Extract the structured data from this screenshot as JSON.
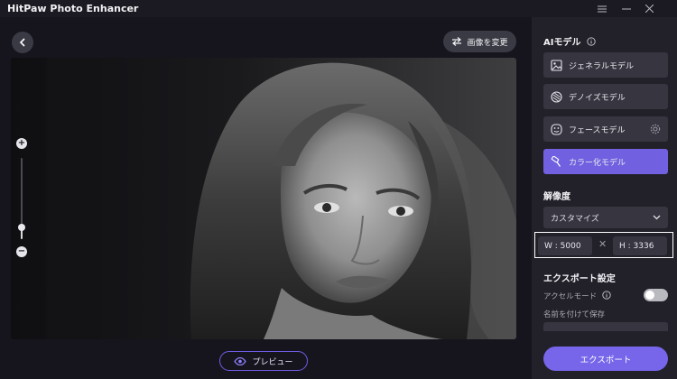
{
  "app": {
    "title": "HitPaw Photo Enhancer"
  },
  "window_controls": {
    "menu_icon": "hamburger-icon",
    "minimize_icon": "minimize-icon",
    "close_icon": "close-icon"
  },
  "toolbar": {
    "back_icon": "chevron-left-icon",
    "change_image_label": "画像を変更",
    "change_image_icon": "swap-arrows-icon"
  },
  "canvas": {
    "image": "black-and-white portrait of a young woman with long hair",
    "zoom_in_label": "+",
    "zoom_out_label": "−",
    "zoom_level": 0.15
  },
  "preview": {
    "label": "プレビュー",
    "icon": "eye-icon"
  },
  "panel": {
    "ai_model_title": "AIモデル",
    "models": [
      {
        "label": "ジェネラルモデル",
        "icon": "image-icon",
        "active": false
      },
      {
        "label": "デノイズモデル",
        "icon": "denoise-icon",
        "active": false
      },
      {
        "label": "フェースモデル",
        "icon": "face-icon",
        "active": false,
        "settings_icon": "gear-icon"
      },
      {
        "label": "カラー化モデル",
        "icon": "paint-roller-icon",
        "active": true
      }
    ],
    "resolution_title": "解像度",
    "resolution_select": "カスタマイズ",
    "width": "W : 5000",
    "height": "H : 3336",
    "link_symbol": "✕",
    "export_settings_title": "エクスポート設定",
    "accel_mode_label": "アクセルモード",
    "accel_mode_on": false,
    "save_as_label": "名前を付けて保存",
    "export_label": "エクスポート"
  },
  "colors": {
    "accent": "#7161e0",
    "export": "#7766ea",
    "panel_bg": "#22212a",
    "main_bg": "#16151d"
  }
}
